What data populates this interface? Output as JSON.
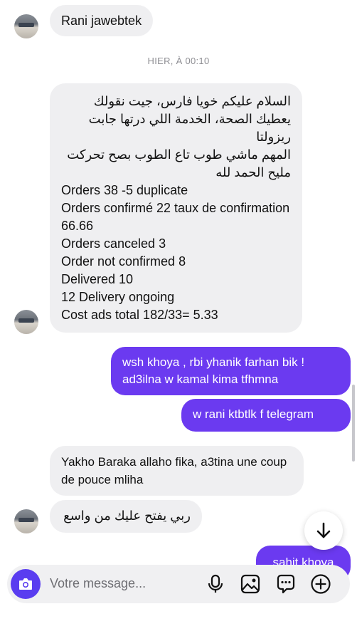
{
  "messages": [
    {
      "side": "in",
      "text": "Rani jawebtek"
    },
    {
      "side": "in",
      "lines": [
        "السلام عليكم خويا فارس، جيت نقولك يعطيك الصحة، الخدمة اللي درتها جابت ريزولتا",
        "المهم ماشي طوب تاع الطوب بصح تحركت مليح الحمد لله",
        "Orders 38 -5 duplicate",
        "Orders confirmé 22 taux de confirmation 66.66",
        "Orders canceled 3",
        "Order not confirmed 8",
        "Delivered 10",
        "12 Delivery ongoing",
        "Cost ads total 182/33= 5.33"
      ]
    },
    {
      "side": "out",
      "text": "wsh khoya , rbi yhanik farhan bik ! ad3ilna w kamal kima tfhmna"
    },
    {
      "side": "out",
      "text": "w rani ktbtlk f telegram"
    },
    {
      "side": "in",
      "text": "Yakho Baraka allaho fika, a3tina une coup de pouce mliha"
    },
    {
      "side": "in",
      "text": "ربي يفتح عليك من واسع"
    },
    {
      "side": "out",
      "text": "sahit khoya"
    }
  ],
  "timestamp": "HIER, À 00:10",
  "composer": {
    "placeholder": "Votre message..."
  },
  "icons": {
    "camera": "camera-icon",
    "mic": "microphone-icon",
    "gallery": "image-icon",
    "sticker": "sticker-icon",
    "add": "plus-icon",
    "scroll_down": "arrow-down-icon"
  },
  "colors": {
    "outgoing": "#6b3af0",
    "incoming": "#efeff1",
    "camera_button": "#5a3df0"
  }
}
